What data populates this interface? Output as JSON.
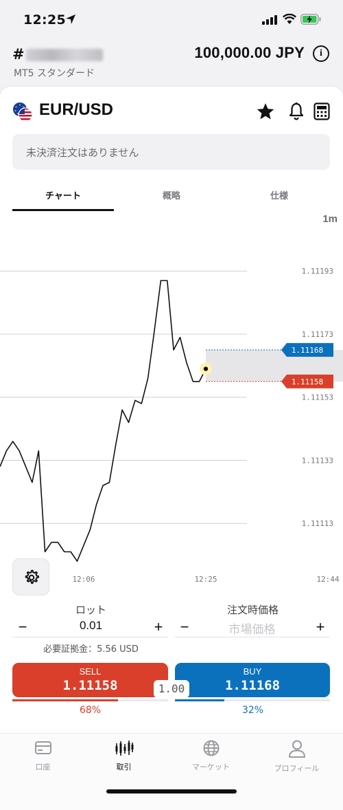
{
  "status_bar": {
    "time": "12:25"
  },
  "account": {
    "id_prefix": "#",
    "type": "MT5 スタンダード",
    "balance": "100,000.00 JPY"
  },
  "instrument": {
    "symbol": "EUR/USD",
    "open_orders_text": "未決済注文はありません"
  },
  "tabs": [
    {
      "label": "チャート",
      "active": true
    },
    {
      "label": "概略",
      "active": false
    },
    {
      "label": "仕様",
      "active": false
    }
  ],
  "chart": {
    "timeframe": "1m",
    "y_ticks": [
      "1.11193",
      "1.11173",
      "1.11153",
      "1.11133",
      "1.11113"
    ],
    "x_ticks": [
      "12:06",
      "12:25",
      "12:44"
    ],
    "ask_label": "1.11168",
    "bid_label": "1.11158",
    "colors": {
      "ask": "#0c71bd",
      "bid": "#d93f2a",
      "line": "#111111"
    }
  },
  "chart_data": {
    "type": "line",
    "ylim": [
      1.11098,
      1.11207
    ],
    "y_ticks": [
      1.11193,
      1.11173,
      1.11153,
      1.11133,
      1.11113
    ],
    "x_ticks": [
      "12:06",
      "12:25",
      "12:44"
    ],
    "series": [
      {
        "values": [
          1.11131,
          1.11136,
          1.11139,
          1.11136,
          1.11131,
          1.11126,
          1.11136,
          1.11104,
          1.11107,
          1.11107,
          1.11104,
          1.11104,
          1.11101,
          1.11106,
          1.11111,
          1.11119,
          1.11125,
          1.11126,
          1.11138,
          1.11149,
          1.11145,
          1.11152,
          1.11151,
          1.11159,
          1.11174,
          1.1119,
          1.1119,
          1.11168,
          1.11172,
          1.11164,
          1.11158,
          1.11158,
          1.11162
        ]
      }
    ],
    "ask": 1.11168,
    "bid": 1.11158
  },
  "order_form": {
    "lot_label": "ロット",
    "lot_value": "0.01",
    "price_label": "注文時価格",
    "price_placeholder": "市場価格",
    "minus": "−",
    "plus": "+",
    "margin_text": "必要証拠金：5.56 USD",
    "sell_label": "SELL",
    "sell_price": "1.11158",
    "buy_label": "BUY",
    "buy_price": "1.11168",
    "spread": "1.00",
    "sell_pct": "68%",
    "buy_pct": "32%",
    "sell_fraction": 0.68,
    "buy_fraction": 0.32
  },
  "tab_bar": [
    {
      "label": "口座",
      "icon": "card-icon",
      "active": false
    },
    {
      "label": "取引",
      "icon": "candles-icon",
      "active": true
    },
    {
      "label": "マーケット",
      "icon": "globe-icon",
      "active": false
    },
    {
      "label": "プロフィール",
      "icon": "person-icon",
      "active": false
    }
  ]
}
